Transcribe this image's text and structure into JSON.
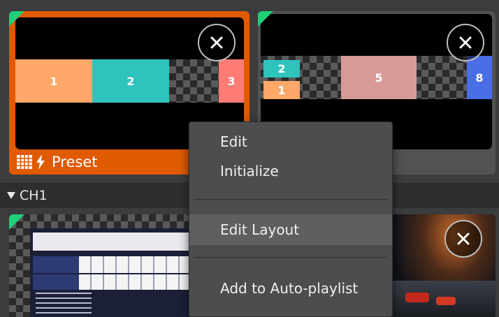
{
  "presets": [
    {
      "label": "Preset",
      "selected": true,
      "blocks": [
        {
          "label": "1",
          "color": "#ffa86a"
        },
        {
          "label": "2",
          "color": "#2ec4bd"
        },
        {
          "label": "3",
          "color": "#ff7b76"
        }
      ]
    },
    {
      "label": "",
      "selected": false,
      "blocks": [
        {
          "label": "2",
          "color": "#2ec4bd"
        },
        {
          "label": "1",
          "color": "#ffa86a"
        },
        {
          "label": "5",
          "color": "#d89a97"
        },
        {
          "label": "8",
          "color": "#4a6de8"
        }
      ]
    }
  ],
  "channel": {
    "name": "CH1"
  },
  "context_menu": {
    "items": [
      "Edit",
      "Initialize",
      "Edit Layout",
      "Add to Auto-playlist"
    ],
    "highlighted": "Edit Layout"
  },
  "colors": {
    "accent": "#e05a00",
    "corner_marker": "#1fd07a",
    "menu_bg": "#4b4d4f",
    "menu_highlight": "#5d5f61"
  },
  "icons": [
    "close-icon",
    "grid-icon",
    "lightning-icon",
    "triangle-down-icon"
  ]
}
